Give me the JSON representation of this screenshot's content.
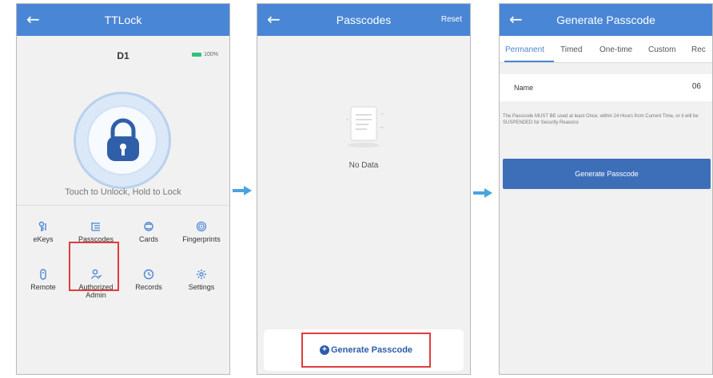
{
  "screen1": {
    "title": "TTLock",
    "lock_name": "D1",
    "battery": "100%",
    "hint": "Touch to Unlock, Hold to Lock",
    "grid": [
      {
        "label": "eKeys",
        "icon": "ekey-icon"
      },
      {
        "label": "Passcodes",
        "icon": "passcode-icon"
      },
      {
        "label": "Cards",
        "icon": "card-icon"
      },
      {
        "label": "Fingerprints",
        "icon": "fingerprint-icon"
      },
      {
        "label": "Remote",
        "icon": "remote-icon"
      },
      {
        "label": "Authorized Admin",
        "icon": "admin-icon"
      },
      {
        "label": "Records",
        "icon": "records-icon"
      },
      {
        "label": "Settings",
        "icon": "settings-icon"
      }
    ]
  },
  "screen2": {
    "title": "Passcodes",
    "reset": "Reset",
    "no_data": "No Data",
    "generate": "Generate Passcode"
  },
  "screen3": {
    "title": "Generate Passcode",
    "tabs": [
      "Permanent",
      "Timed",
      "One-time",
      "Custom",
      "Rec"
    ],
    "active_tab": 0,
    "name_label": "Name",
    "name_value": "06",
    "note": "The Passcode MUST BE used at least Once, within 24 Hours from Current Time, or it will be SUSPENDED for Security Reasons",
    "generate_button": "Generate Passcode"
  },
  "colors": {
    "header": "#4a86d6",
    "highlight": "#e23b3b",
    "button": "#3d6fb8",
    "arrow": "#4aa3e0"
  }
}
